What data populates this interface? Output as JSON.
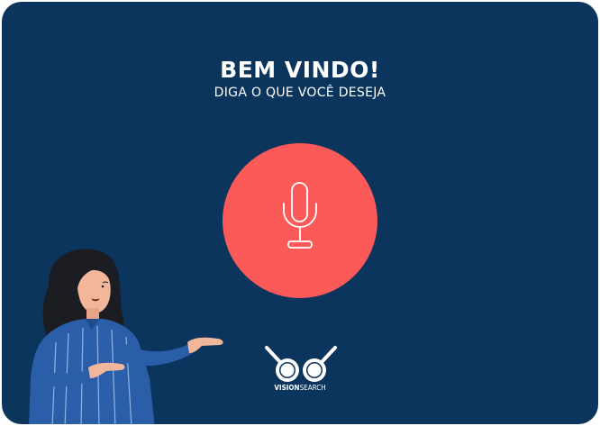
{
  "welcome": {
    "title": "BEM VINDO!",
    "subtitle": "DIGA O QUE VOCÊ DESEJA"
  },
  "mic": {
    "icon": "microphone-icon",
    "color": "#fb5a58"
  },
  "logo": {
    "word_bold": "VISION",
    "word_light": "SEARCH"
  },
  "colors": {
    "background": "#0b355c",
    "accent": "#fb5a58",
    "text": "#ffffff"
  }
}
